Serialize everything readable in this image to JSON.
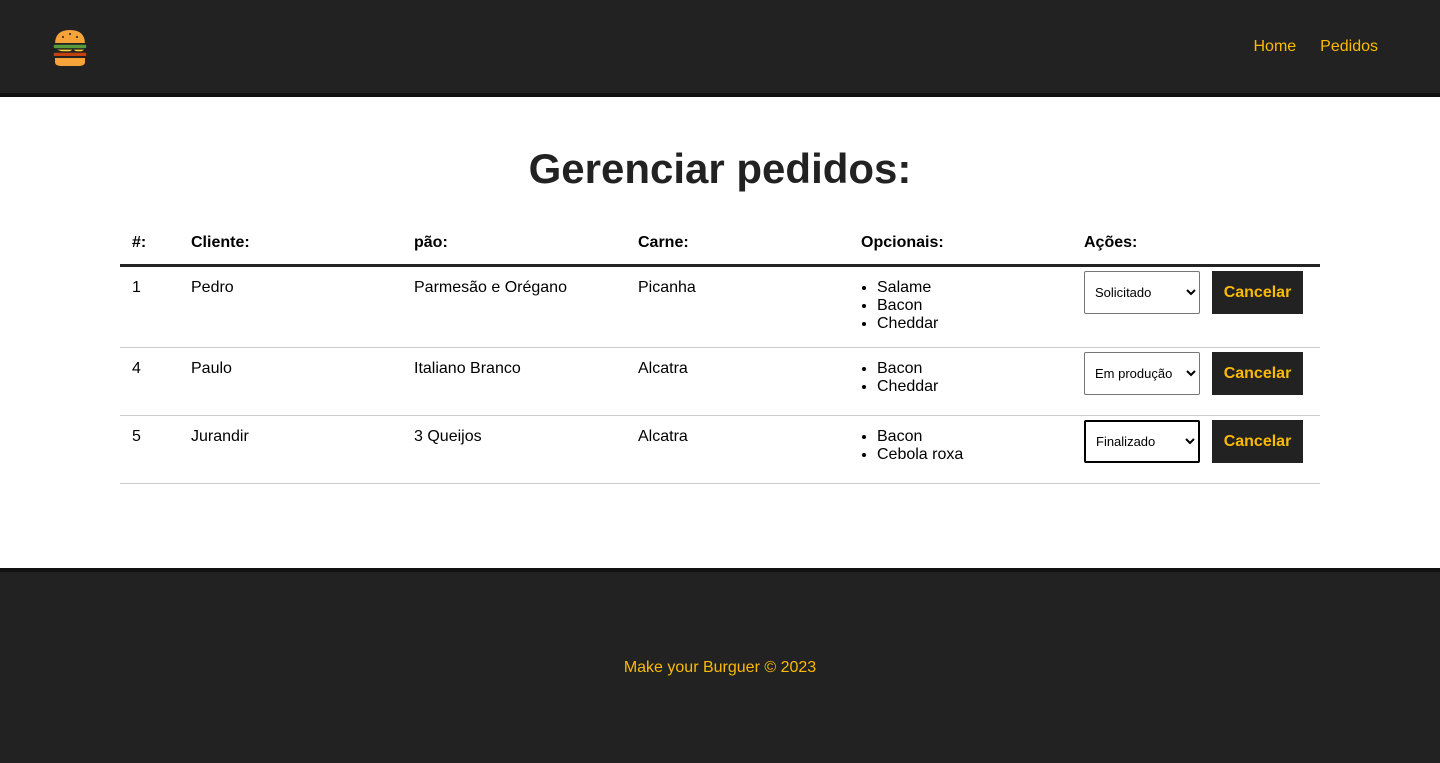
{
  "app": {
    "accent": "#fcba03",
    "dark": "#222222"
  },
  "nav": {
    "logo": "burger-logo-icon",
    "links": [
      "Home",
      "Pedidos"
    ]
  },
  "page": {
    "title": "Gerenciar pedidos:"
  },
  "table": {
    "headers": [
      "#:",
      "Cliente:",
      "pão:",
      "Carne:",
      "Opcionais:",
      "Ações:"
    ],
    "rows": [
      {
        "id": "1",
        "cliente": "Pedro",
        "pao": "Parmesão e Orégano",
        "carne": "Picanha",
        "opcionais": [
          "Salame",
          "Bacon",
          "Cheddar"
        ],
        "status": "Solicitado",
        "cancel_label": "Cancelar"
      },
      {
        "id": "4",
        "cliente": "Paulo",
        "pao": "Italiano Branco",
        "carne": "Alcatra",
        "opcionais": [
          "Bacon",
          "Cheddar"
        ],
        "status": "Em produção",
        "cancel_label": "Cancelar"
      },
      {
        "id": "5",
        "cliente": "Jurandir",
        "pao": "3 Queijos",
        "carne": "Alcatra",
        "opcionais": [
          "Bacon",
          "Cebola roxa"
        ],
        "status": "Finalizado",
        "cancel_label": "Cancelar"
      }
    ]
  },
  "footer": {
    "text": "Make your Burguer © 2023"
  }
}
